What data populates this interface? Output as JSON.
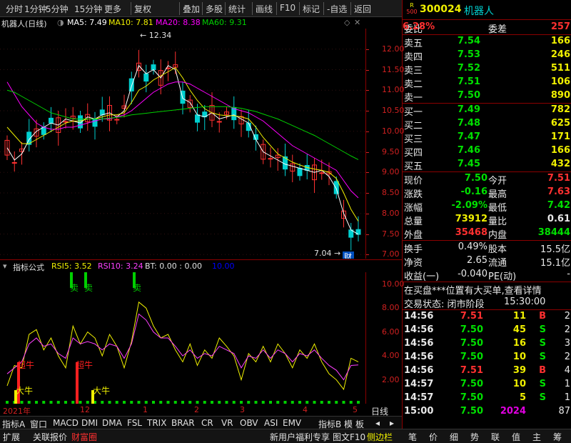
{
  "toolbar": {
    "items": [
      "分时",
      "1分钟",
      "5分钟",
      "15分钟",
      "更多",
      "复权",
      "叠加",
      "多股",
      "统计",
      "画线",
      "F10",
      "标记",
      "-自选",
      "返回"
    ]
  },
  "chart": {
    "name": "机器人(日线)",
    "ma5": "MA5: 7.49",
    "ma10": "MA10: 7.81",
    "ma20": "MA20: 8.38",
    "ma60": "MA60: 9.31",
    "high_label": "12.34",
    "low_label": "7.04",
    "cai": "财",
    "yticks": [
      "12.00",
      "11.50",
      "11.00",
      "10.50",
      "10.00",
      "9.50",
      "9.00",
      "8.50",
      "8.00",
      "7.50",
      "7.00"
    ],
    "colors": {
      "ma5": "#ffffff",
      "ma10": "#f0f000",
      "ma20": "#ff00ff",
      "ma60": "#00d000"
    }
  },
  "chart_data": {
    "type": "line",
    "ylim": [
      6.9,
      12.5
    ],
    "series": [
      {
        "name": "MA5",
        "values": [
          9.6,
          9.3,
          9.45,
          9.8,
          10.0,
          10.1,
          10.2,
          10.15,
          10.3,
          10.25,
          10.2,
          10.35,
          10.3,
          10.4,
          10.45,
          10.35,
          10.5,
          11.1,
          11.6,
          11.4,
          11.5,
          11.3,
          11.6,
          11.5,
          10.8,
          10.7,
          10.4,
          10.35,
          10.45,
          10.3,
          10.35,
          10.4,
          10.3,
          10.2,
          9.8,
          9.5,
          9.4,
          9.3,
          9.2,
          9.15,
          9.1,
          9.05,
          9.0,
          9.05,
          8.9,
          8.6,
          8.0,
          7.6,
          7.49
        ]
      },
      {
        "name": "MA10",
        "values": [
          10.1,
          9.9,
          9.7,
          9.7,
          9.8,
          9.9,
          10.0,
          10.1,
          10.2,
          10.25,
          10.25,
          10.3,
          10.3,
          10.35,
          10.4,
          10.4,
          10.45,
          10.7,
          11.0,
          11.1,
          11.25,
          11.35,
          11.45,
          11.55,
          11.3,
          11.0,
          10.75,
          10.55,
          10.45,
          10.4,
          10.38,
          10.38,
          10.35,
          10.3,
          10.1,
          9.85,
          9.65,
          9.45,
          9.35,
          9.25,
          9.18,
          9.12,
          9.08,
          9.05,
          9.0,
          8.85,
          8.5,
          8.1,
          7.81
        ]
      },
      {
        "name": "MA20",
        "values": [
          11.2,
          10.9,
          10.6,
          10.4,
          10.2,
          10.1,
          10.05,
          10.05,
          10.1,
          10.1,
          10.15,
          10.2,
          10.25,
          10.3,
          10.3,
          10.35,
          10.4,
          10.5,
          10.65,
          10.8,
          10.95,
          11.05,
          11.15,
          11.2,
          11.2,
          11.15,
          11.05,
          10.95,
          10.85,
          10.75,
          10.65,
          10.55,
          10.5,
          10.45,
          10.35,
          10.25,
          10.1,
          9.95,
          9.8,
          9.65,
          9.55,
          9.45,
          9.35,
          9.25,
          9.15,
          9.05,
          8.8,
          8.55,
          8.38
        ]
      },
      {
        "name": "MA60",
        "values": [
          11.0,
          10.95,
          10.85,
          10.75,
          10.65,
          10.55,
          10.45,
          10.4,
          10.35,
          10.3,
          10.3,
          10.3,
          10.3,
          10.3,
          10.32,
          10.34,
          10.36,
          10.4,
          10.42,
          10.44,
          10.46,
          10.48,
          10.5,
          10.52,
          10.54,
          10.56,
          10.58,
          10.6,
          10.6,
          10.6,
          10.6,
          10.58,
          10.56,
          10.52,
          10.48,
          10.42,
          10.36,
          10.3,
          10.22,
          10.14,
          10.06,
          9.98,
          9.9,
          9.8,
          9.7,
          9.6,
          9.5,
          9.4,
          9.31
        ]
      }
    ]
  },
  "indicator": {
    "title": "指标公式",
    "rsi5": "RSI5: 3.52",
    "rsi10": "RSI10: 3.24",
    "bt": "BT: 0.00 : 0.00",
    "ten": "10.00",
    "yticks": [
      "10.00",
      "8.00",
      "6.00",
      "4.00",
      "2.00"
    ],
    "sell1": "卖",
    "sell2": "卖",
    "sell3": "卖",
    "bull1": "超牛",
    "bull2": "超牛",
    "bull3": "大牛",
    "bull4": "大牛"
  },
  "indicator_data": {
    "type": "line",
    "ylim": [
      0,
      11
    ],
    "series": [
      {
        "name": "RSI5",
        "values": [
          1.5,
          3.2,
          3.0,
          5.8,
          6.2,
          4.5,
          5.5,
          4.0,
          3.0,
          6.5,
          5.0,
          6.0,
          5.5,
          4.0,
          5.8,
          4.8,
          3.0,
          5.2,
          8.5,
          8.0,
          6.5,
          5.5,
          5.8,
          4.5,
          3.5,
          5.0,
          3.2,
          4.5,
          3.8,
          5.5,
          4.8,
          4.0,
          2.0,
          4.2,
          3.5,
          4.8,
          3.5,
          5.0,
          4.2,
          3.0,
          4.5,
          3.8,
          5.0,
          3.5,
          2.5,
          2.0,
          1.2,
          3.8,
          3.5
        ]
      },
      {
        "name": "RSI10",
        "values": [
          2.5,
          3.0,
          3.5,
          5.0,
          5.5,
          4.8,
          5.0,
          4.2,
          3.8,
          5.5,
          5.0,
          5.2,
          5.0,
          4.5,
          5.0,
          4.8,
          3.8,
          5.0,
          7.5,
          7.0,
          6.0,
          5.5,
          5.5,
          4.8,
          4.0,
          4.5,
          3.8,
          4.2,
          4.0,
          4.8,
          4.5,
          4.2,
          3.0,
          4.0,
          3.8,
          4.5,
          3.8,
          4.5,
          4.2,
          3.5,
          4.2,
          4.0,
          4.5,
          3.8,
          3.2,
          2.8,
          2.0,
          3.2,
          3.24
        ]
      }
    ]
  },
  "xaxis": {
    "labels": [
      "2021年",
      "12",
      "1",
      "2",
      "3",
      "4",
      "5"
    ],
    "period": "日线"
  },
  "tabs": [
    "指标A",
    "窗口",
    "MACD",
    "DMI",
    "DMA",
    "FSL",
    "TRIX",
    "BRAR",
    "CR",
    "VR",
    "OBV",
    "ASI",
    "EMV",
    "指标B",
    "模",
    "板",
    "◂",
    "▸"
  ],
  "bottom": {
    "items": [
      "扩展",
      "关联报价",
      "财富圈",
      "新用户福利专享",
      "图文F10",
      "侧边栏"
    ],
    "right": [
      "笔",
      "价",
      "细",
      "势",
      "联",
      "值",
      "主",
      "筹"
    ]
  },
  "quote": {
    "badge_top": "R",
    "badge_bot": "500",
    "code": "300024",
    "name": "机器人",
    "weibi_label": "委比",
    "weibi": "6.28%",
    "weicha_label": "委差",
    "weicha": "257",
    "asks": [
      {
        "label": "卖五",
        "price": "7.54",
        "vol": "166"
      },
      {
        "label": "卖四",
        "price": "7.53",
        "vol": "246"
      },
      {
        "label": "卖三",
        "price": "7.52",
        "vol": "511"
      },
      {
        "label": "卖二",
        "price": "7.51",
        "vol": "106"
      },
      {
        "label": "卖一",
        "price": "7.50",
        "vol": "890"
      }
    ],
    "bids": [
      {
        "label": "买一",
        "price": "7.49",
        "vol": "782"
      },
      {
        "label": "买二",
        "price": "7.48",
        "vol": "625"
      },
      {
        "label": "买三",
        "price": "7.47",
        "vol": "171"
      },
      {
        "label": "买四",
        "price": "7.46",
        "vol": "166"
      },
      {
        "label": "买五",
        "price": "7.45",
        "vol": "432"
      }
    ],
    "stats": [
      {
        "l1": "现价",
        "v1": "7.50",
        "l2": "今开",
        "v2": "7.51"
      },
      {
        "l1": "涨跌",
        "v1": "-0.16",
        "l2": "最高",
        "v2": "7.63"
      },
      {
        "l1": "涨幅",
        "v1": "-2.09%",
        "l2": "最低",
        "v2": "7.42"
      },
      {
        "l1": "总量",
        "v1": "73912",
        "l2": "量比",
        "v2": "0.61"
      },
      {
        "l1": "外盘",
        "v1": "35468",
        "l2": "内盘",
        "v2": "38444"
      }
    ],
    "stats2": [
      {
        "l1": "换手",
        "v1": "0.49%",
        "l2": "股本",
        "v2": "15.5亿"
      },
      {
        "l1": "净资",
        "v1": "2.65",
        "l2": "流通",
        "v2": "15.1亿"
      },
      {
        "l1": "收益(一)",
        "v1": "-0.040",
        "l2": "PE(动)",
        "v2": "-"
      }
    ],
    "notice": "在买盘***位置有大买单,查看详情",
    "status_label": "交易状态: 闭市阶段",
    "status_time": "15:30:00",
    "trades": [
      {
        "t": "14:56",
        "p": "7.51",
        "v": "11",
        "s": "B",
        "x": "2"
      },
      {
        "t": "14:56",
        "p": "7.50",
        "v": "45",
        "s": "S",
        "x": "2"
      },
      {
        "t": "14:56",
        "p": "7.50",
        "v": "16",
        "s": "S",
        "x": "3"
      },
      {
        "t": "14:56",
        "p": "7.50",
        "v": "10",
        "s": "S",
        "x": "2"
      },
      {
        "t": "14:56",
        "p": "7.51",
        "v": "39",
        "s": "B",
        "x": "4"
      },
      {
        "t": "14:57",
        "p": "7.50",
        "v": "10",
        "s": "S",
        "x": "1"
      },
      {
        "t": "14:57",
        "p": "7.50",
        "v": "5",
        "s": "S",
        "x": "1"
      },
      {
        "t": "15:00",
        "p": "7.50",
        "v": "2024",
        "s": "",
        "x": "87"
      }
    ]
  }
}
